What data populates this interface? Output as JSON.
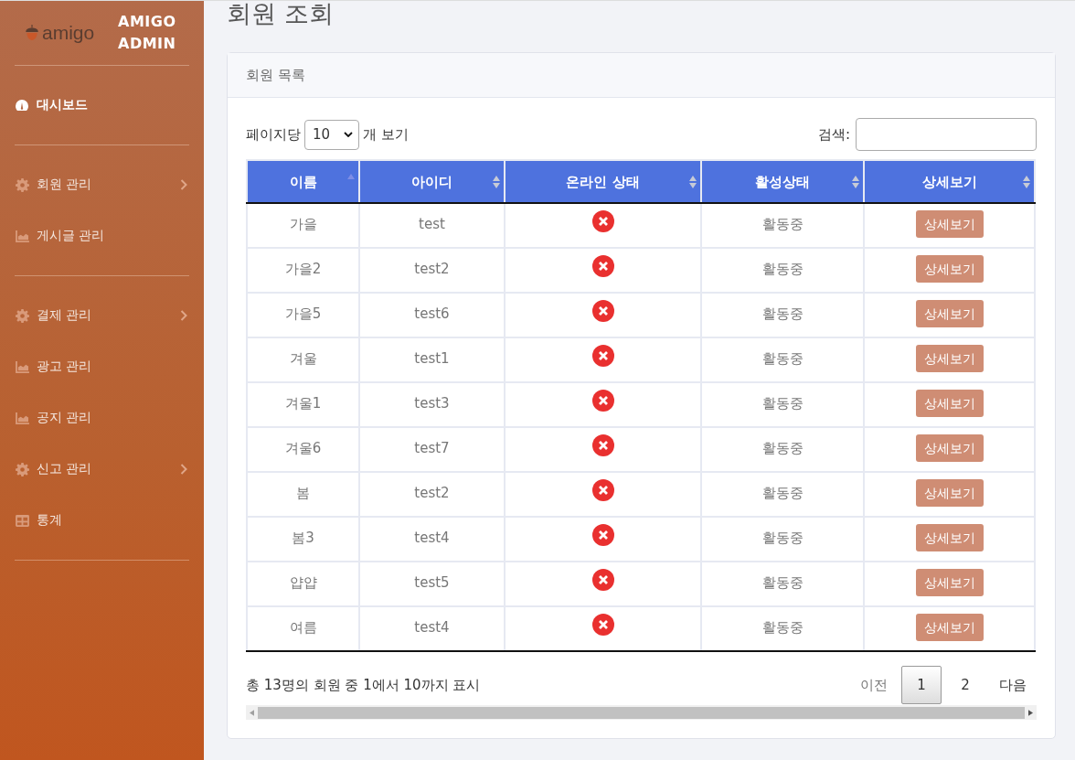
{
  "sidebar": {
    "logo_text": "amigo",
    "brand": "AMIGO ADMIN",
    "groups": [
      [
        {
          "label": "대시보드",
          "kind": "gauge",
          "selected": true,
          "expandable": false
        }
      ],
      [
        {
          "label": "회원 관리",
          "kind": "gear",
          "selected": false,
          "expandable": true
        },
        {
          "label": "게시글 관리",
          "kind": "chart",
          "selected": false,
          "expandable": false
        }
      ],
      [
        {
          "label": "결제 관리",
          "kind": "gear",
          "selected": false,
          "expandable": true
        },
        {
          "label": "광고 관리",
          "kind": "chart",
          "selected": false,
          "expandable": false
        },
        {
          "label": "공지 관리",
          "kind": "chart",
          "selected": false,
          "expandable": false
        },
        {
          "label": "신고 관리",
          "kind": "gear",
          "selected": false,
          "expandable": true
        },
        {
          "label": "통계",
          "kind": "table",
          "selected": false,
          "expandable": false
        }
      ]
    ]
  },
  "page_title": "회원 조회",
  "card": {
    "title": "회원 목록",
    "length": {
      "before": "페이지당",
      "value": "10",
      "after": "개 보기"
    },
    "search": {
      "label": "검색:"
    },
    "table": {
      "columns": [
        {
          "label": "이름",
          "sorted": true
        },
        {
          "label": "아이디",
          "sorted": false
        },
        {
          "label": "온라인 상태",
          "sorted": false
        },
        {
          "label": "활성상태",
          "sorted": false
        },
        {
          "label": "상세보기",
          "sorted": false
        }
      ],
      "rows": [
        {
          "name": "가을",
          "id": "test",
          "online": false,
          "status": "활동중",
          "action": "상세보기"
        },
        {
          "name": "가을2",
          "id": "test2",
          "online": false,
          "status": "활동중",
          "action": "상세보기"
        },
        {
          "name": "가을5",
          "id": "test6",
          "online": false,
          "status": "활동중",
          "action": "상세보기"
        },
        {
          "name": "겨울",
          "id": "test1",
          "online": false,
          "status": "활동중",
          "action": "상세보기"
        },
        {
          "name": "겨울1",
          "id": "test3",
          "online": false,
          "status": "활동중",
          "action": "상세보기"
        },
        {
          "name": "겨울6",
          "id": "test7",
          "online": false,
          "status": "활동중",
          "action": "상세보기"
        },
        {
          "name": "봄",
          "id": "test2",
          "online": false,
          "status": "활동중",
          "action": "상세보기"
        },
        {
          "name": "봄3",
          "id": "test4",
          "online": false,
          "status": "활동중",
          "action": "상세보기"
        },
        {
          "name": "얍얍",
          "id": "test5",
          "online": false,
          "status": "활동중",
          "action": "상세보기"
        },
        {
          "name": "여름",
          "id": "test4",
          "online": false,
          "status": "활동중",
          "action": "상세보기"
        }
      ]
    },
    "info": "총 13명의 회원 중 1에서 10까지 표시",
    "pagination": [
      {
        "label": "이전",
        "selected": false,
        "disabled": true
      },
      {
        "label": "1",
        "selected": true,
        "disabled": false
      },
      {
        "label": "2",
        "selected": false,
        "disabled": false
      },
      {
        "label": "다음",
        "selected": false,
        "disabled": false
      }
    ]
  }
}
